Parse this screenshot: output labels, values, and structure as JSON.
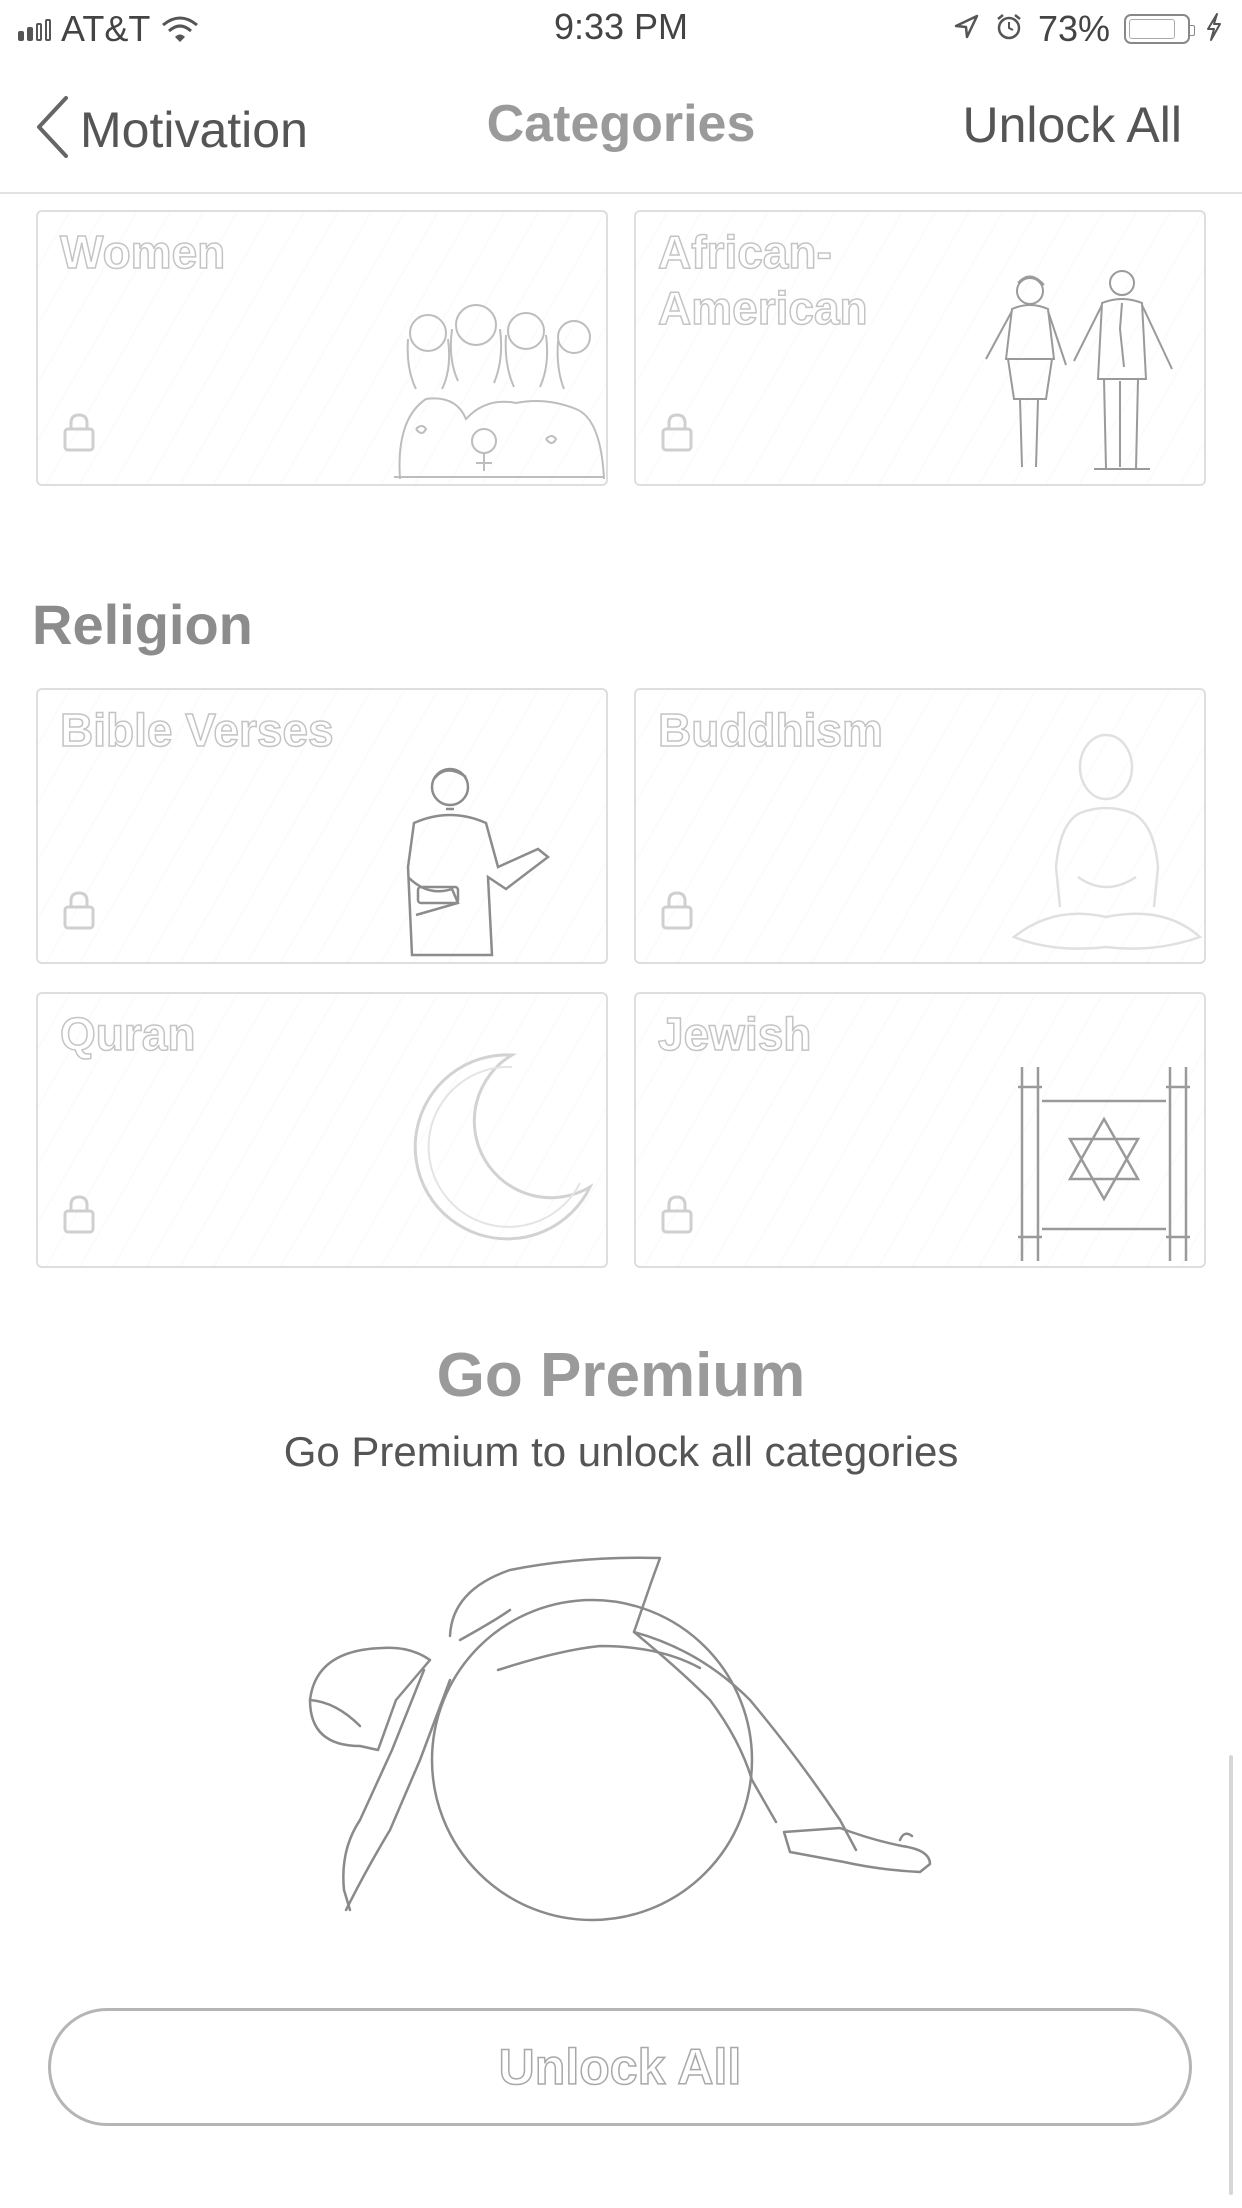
{
  "status_bar": {
    "carrier": "AT&T",
    "time": "9:33 PM",
    "battery_percent": "73%",
    "icons": [
      "signal-icon",
      "wifi-icon",
      "location-icon",
      "alarm-icon",
      "battery-icon",
      "charging-icon"
    ]
  },
  "nav": {
    "back_label": "Motivation",
    "title": "Categories",
    "action_label": "Unlock All"
  },
  "categories_top": [
    {
      "title": "Women",
      "icon": "women-group-illustration",
      "locked": true
    },
    {
      "title": "African-American",
      "icon": "couple-illustration",
      "locked": true
    }
  ],
  "religion": {
    "title": "Religion",
    "cards": [
      {
        "title": "Bible Verses",
        "icon": "preacher-illustration",
        "locked": true
      },
      {
        "title": "Buddhism",
        "icon": "buddha-illustration",
        "locked": true
      },
      {
        "title": "Quran",
        "icon": "crescent-moon-illustration",
        "locked": true
      },
      {
        "title": "Jewish",
        "icon": "torah-scroll-illustration",
        "locked": true
      }
    ]
  },
  "premium": {
    "title": "Go Premium",
    "subtitle": "Go Premium to unlock all categories",
    "illustration": "yoga-ball-stretch-illustration",
    "button_label": "Unlock All"
  },
  "colors": {
    "background": "#ffffff",
    "text": "#555555",
    "muted_outline": "#c4c4c4",
    "border": "#dedede"
  }
}
